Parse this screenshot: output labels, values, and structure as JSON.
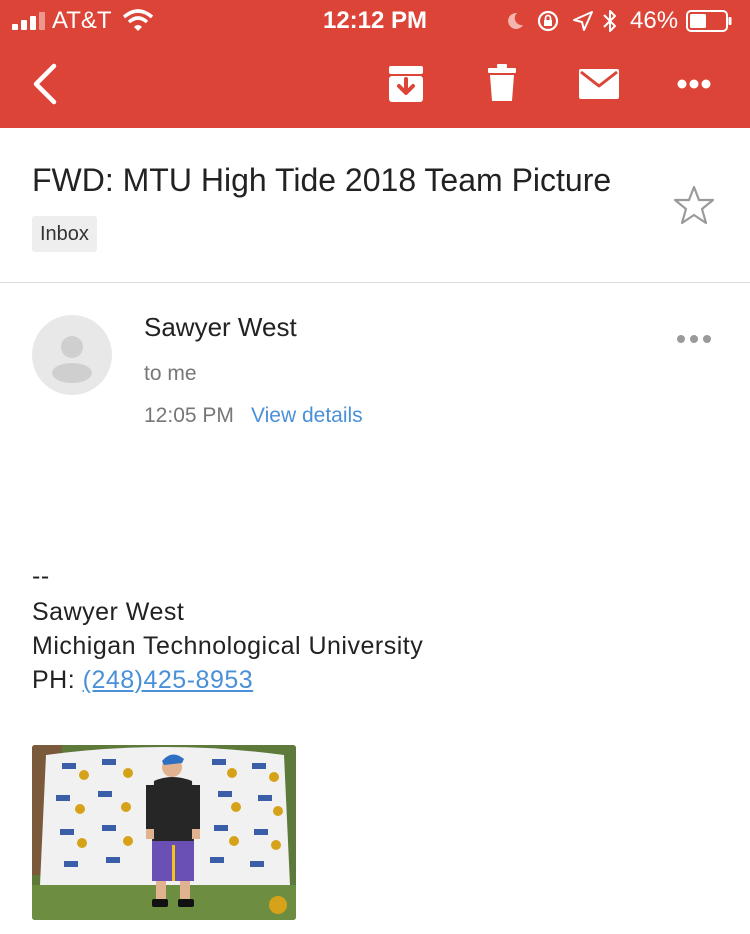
{
  "status_bar": {
    "carrier": "AT&T",
    "time": "12:12 PM",
    "battery_percent": "46%",
    "icons": [
      "signal-icon",
      "wifi-icon",
      "moon-icon",
      "rotation-lock-icon",
      "location-icon",
      "bluetooth-icon",
      "battery-icon"
    ]
  },
  "toolbar": {
    "icons": [
      "back-arrow-icon",
      "archive-icon",
      "trash-icon",
      "mail-icon",
      "more-icon"
    ]
  },
  "email": {
    "subject": "FWD: MTU High Tide 2018 Team Picture",
    "label": "Inbox",
    "starred": false,
    "sender_name": "Sawyer West",
    "recipient_line": "to me",
    "time": "12:05 PM",
    "view_details": "View details"
  },
  "body": {
    "dashes": "--",
    "sig_name": "Sawyer West",
    "sig_org": "Michigan Technological University",
    "sig_phone_label": "PH:",
    "sig_phone": "(248)425-8953"
  },
  "colors": {
    "header_red": "#db4437",
    "link_blue": "#4a90d9"
  }
}
